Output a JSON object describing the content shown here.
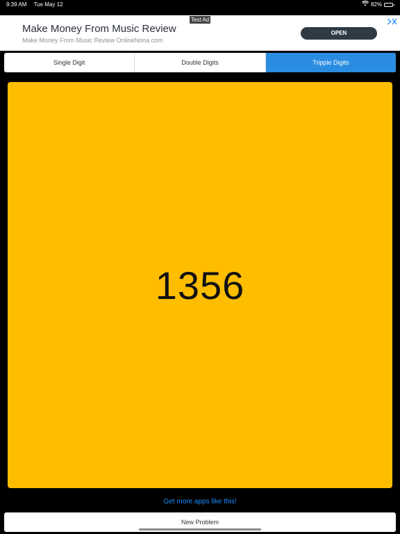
{
  "status_bar": {
    "time": "9:39 AM",
    "date": "Tue May 12",
    "battery": "82%",
    "battery_level": 0.82
  },
  "ad": {
    "tag": "Test Ad",
    "title": "Make Money From Music Review",
    "subtitle": "Make Money From Music Review OnlineNona.com",
    "open_label": "OPEN"
  },
  "tabs": [
    {
      "label": "Single Digit",
      "selected": false
    },
    {
      "label": "Double Digits",
      "selected": false
    },
    {
      "label": "Tripple Digits",
      "selected": true
    }
  ],
  "problem": {
    "number": "1356",
    "panel_color": "#ffbd00"
  },
  "links": {
    "more_apps": "Get more apps like this!"
  },
  "actions": {
    "new_problem": "New Problem"
  },
  "colors": {
    "accent": "#2a8de1",
    "link": "#1a8cff"
  }
}
